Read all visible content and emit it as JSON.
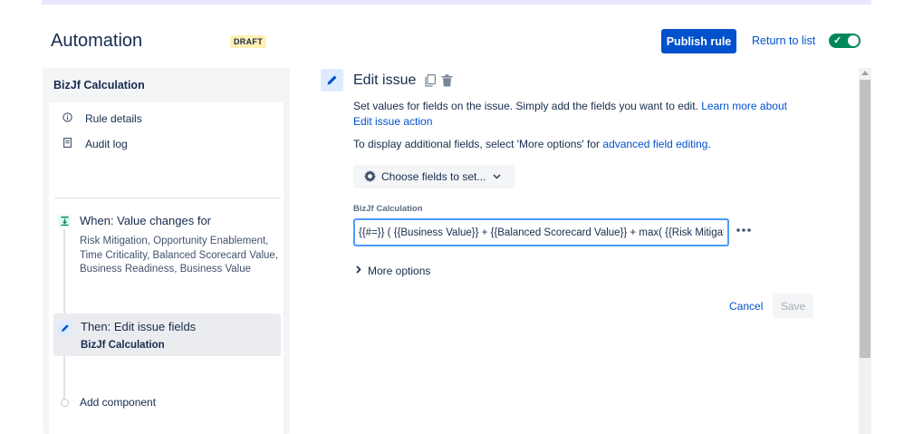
{
  "header": {
    "title": "Automation",
    "status_badge": "DRAFT",
    "publish_label": "Publish rule",
    "return_label": "Return to list",
    "toggle_on": true,
    "toggle_check": "✓"
  },
  "sidebar": {
    "rule_name": "BizJf Calculation",
    "links": [
      {
        "label": "Rule details",
        "icon": "info-icon"
      },
      {
        "label": "Audit log",
        "icon": "document-icon"
      }
    ],
    "trigger": {
      "title": "When: Value changes for",
      "description": "Risk Mitigation, Opportunity Enablement, Time Criticality, Balanced Scorecard Value, Business Readiness, Business Value"
    },
    "action": {
      "title": "Then: Edit issue fields",
      "subtitle": "BizJf Calculation"
    },
    "add_component_label": "Add component"
  },
  "main": {
    "title": "Edit issue",
    "description_text": "Set values for fields on the issue. Simply add the fields you want to edit. ",
    "description_link": "Learn more about Edit issue action",
    "display_text": "To display additional fields, select 'More options' for ",
    "display_link": "advanced field editing",
    "display_suffix": ".",
    "choose_fields_label": "Choose fields to set...",
    "field_label": "BizJf Calculation",
    "field_value": "{{#=}} ( {{Business Value}} + {{Balanced Scorecard Value}} + max( {{Risk Mitigation}}",
    "more_options_label": "More options",
    "cancel_label": "Cancel",
    "save_label": "Save"
  },
  "colors": {
    "primary": "#0052cc",
    "toggle_on": "#00875a",
    "draft_badge": "#fff0b3",
    "focus_border": "#4c9aff"
  }
}
